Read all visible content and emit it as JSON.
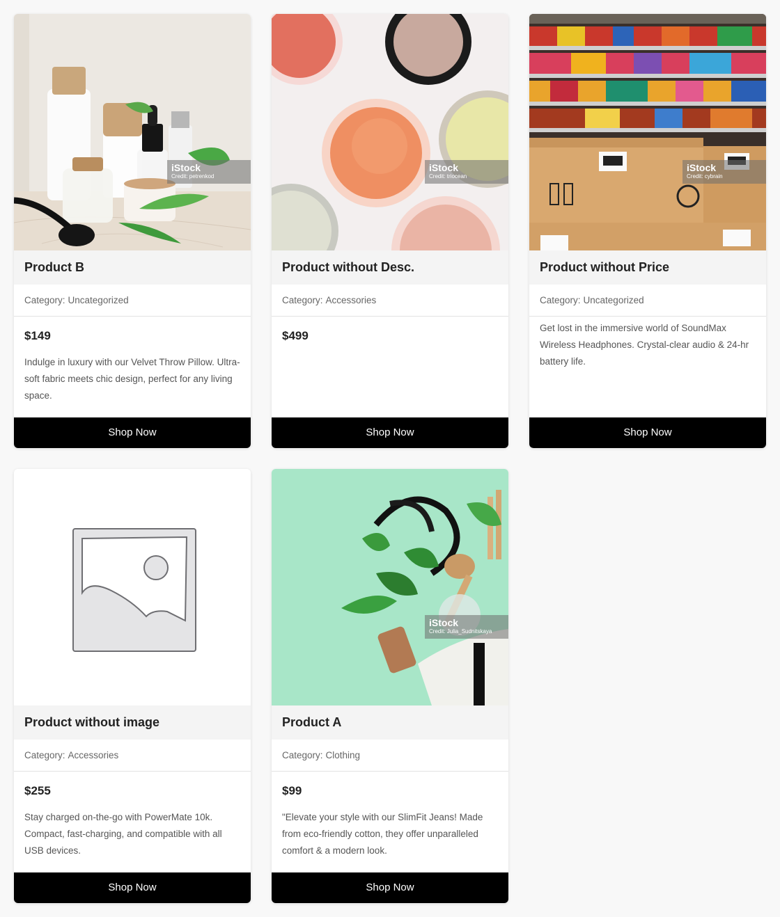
{
  "products": [
    {
      "title": "Product B",
      "category_label": "Category:",
      "category": "Uncategorized",
      "price": "$149",
      "description": "Indulge in luxury with our Velvet Throw Pillow. Ultra-soft fabric meets chic design, perfect for any living space.",
      "button": "Shop Now",
      "image_subject": "skincare-bottles-photo",
      "watermark_brand": "iStock",
      "watermark_credit": "Credit: petrenkod"
    },
    {
      "title": "Product without Desc.",
      "category_label": "Category:",
      "category": "Accessories",
      "price": "$499",
      "description": "",
      "button": "Shop Now",
      "image_subject": "cosmetic-jars-photo",
      "watermark_brand": "iStock",
      "watermark_credit": "Credit: triocean"
    },
    {
      "title": "Product without Price",
      "category_label": "Category:",
      "category": "Uncategorized",
      "price": "",
      "description": "Get lost in the immersive world of SoundMax Wireless Headphones. Crystal-clear audio & 24-hr battery life.",
      "button": "Shop Now",
      "image_subject": "store-shelves-boxes-photo",
      "watermark_brand": "iStock",
      "watermark_credit": "Credit: cybrain"
    },
    {
      "title": "Product without image",
      "category_label": "Category:",
      "category": "Accessories",
      "price": "$255",
      "description": "Stay charged on-the-go with PowerMate 10k. Compact, fast-charging, and compatible with all USB devices.",
      "button": "Shop Now",
      "image_subject": "image-placeholder-icon"
    },
    {
      "title": "Product A",
      "category_label": "Category:",
      "category": "Clothing",
      "price": "$99",
      "description": "\"Elevate your style with our SlimFit Jeans! Made from eco-friendly cotton, they offer unparalleled comfort & a modern look.",
      "button": "Shop Now",
      "image_subject": "eco-tote-bag-photo",
      "watermark_brand": "iStock",
      "watermark_credit": "Credit: Julia_Sudnitskaya"
    }
  ],
  "colors": {
    "page_background": "#f8f8f8",
    "card_background": "#ffffff",
    "title_bar": "#f4f4f4",
    "button_background": "#000000",
    "button_text": "#ffffff",
    "category_text": "#666666",
    "mint_background": "#a8e6c8"
  }
}
